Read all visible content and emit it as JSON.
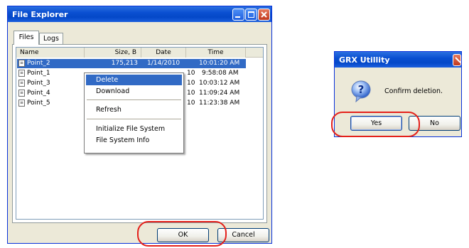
{
  "explorer": {
    "title": "File Explorer",
    "tabs": [
      {
        "label": "Files"
      },
      {
        "label": "Logs"
      }
    ],
    "columns": {
      "name": "Name",
      "size": "Size, B",
      "date": "Date",
      "time": "Time"
    },
    "rows": [
      {
        "name": "Point_2",
        "size": "175,213",
        "date": "1/14/2010",
        "time": "10:01:20 AM"
      },
      {
        "name": "Point_1",
        "date": "10",
        "time": "9:58:08 AM"
      },
      {
        "name": "Point_3",
        "date": "10",
        "time": "10:03:12 AM"
      },
      {
        "name": "Point_4",
        "date": "10",
        "time": "11:09:24 AM"
      },
      {
        "name": "Point_5",
        "date": "10",
        "time": "11:23:38 AM"
      }
    ],
    "context_menu": {
      "items": [
        "Delete",
        "Download",
        "Refresh",
        "Initialize File System",
        "File System Info"
      ]
    },
    "ok_label": "OK",
    "cancel_label": "Cancel"
  },
  "dialog": {
    "title": "GRX Utillity",
    "message": "Confirm deletion.",
    "icon": "question-icon",
    "yes_label": "Yes",
    "no_label": "No"
  },
  "colors": {
    "titlebar": "#0a4fd1",
    "selection": "#316ac5",
    "highlight_oval": "#e4211b"
  }
}
